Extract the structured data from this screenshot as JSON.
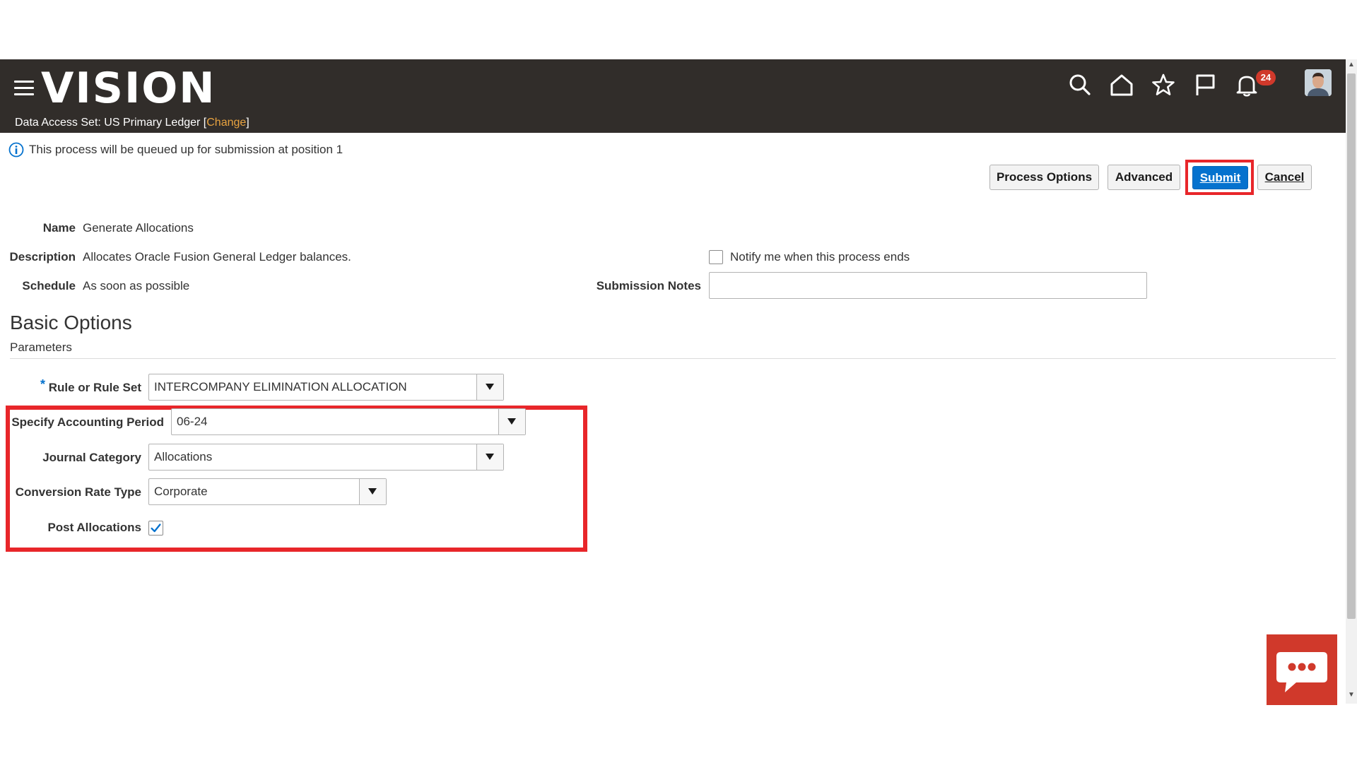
{
  "header": {
    "logo_text": "VISION",
    "data_access_set_label": "Data Access Set:",
    "data_access_set_value": "US Primary Ledger",
    "change_link_open": " [",
    "change_link": "Change",
    "change_link_close": "]",
    "notification_count": "24",
    "icons": [
      "hamburger-menu-icon",
      "search-icon",
      "home-icon",
      "star-icon",
      "flag-icon",
      "bell-icon",
      "user-avatar"
    ]
  },
  "info_message": "This process will be queued up for submission at position 1",
  "toolbar": {
    "process_options_label": "Process Options",
    "advanced_label": "Advanced",
    "submit_label": "Submit",
    "cancel_label": "Cancel"
  },
  "process": {
    "name_label": "Name",
    "name_value": "Generate Allocations",
    "description_label": "Description",
    "description_value": "Allocates Oracle Fusion General Ledger balances.",
    "schedule_label": "Schedule",
    "schedule_value": "As soon as possible",
    "notify_label": "Notify me when this process ends",
    "notify_checked": false,
    "submission_notes_label": "Submission Notes",
    "submission_notes_value": ""
  },
  "basic_options": {
    "title": "Basic Options",
    "parameters_title": "Parameters",
    "required_marker": "*",
    "rule_label": "Rule or Rule Set",
    "rule_value": "INTERCOMPANY ELIMINATION ALLOCATION",
    "period_label": "Specify Accounting Period",
    "period_value": "06-24",
    "journal_category_label": "Journal Category",
    "journal_category_value": "Allocations",
    "conversion_rate_type_label": "Conversion Rate Type",
    "conversion_rate_type_value": "Corporate",
    "post_allocations_label": "Post Allocations",
    "post_allocations_checked": true
  },
  "colors": {
    "header_bg": "#312d2a",
    "accent_blue": "#0572ce",
    "highlight_red": "#e8262a",
    "change_link": "#e8a340",
    "chat_bg": "#d0392b"
  }
}
